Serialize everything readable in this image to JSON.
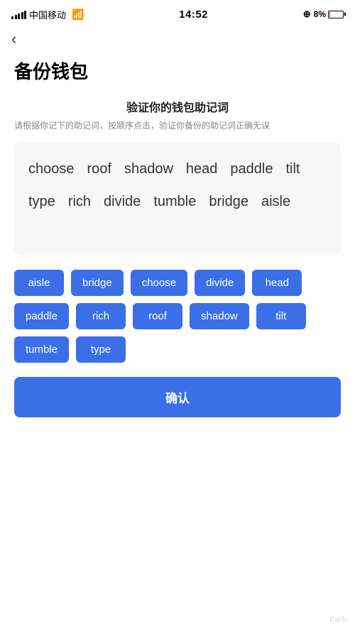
{
  "statusBar": {
    "carrier": "中国移动",
    "time": "14:52",
    "batteryPercent": "8%"
  },
  "nav": {
    "backLabel": "‹"
  },
  "page": {
    "title": "备份钱包",
    "sectionTitle": "验证你的钱包助记词",
    "sectionDesc": "请根据你记下的助记词，按顺序点击，验证你备份的助记词正确无误"
  },
  "displayWords": [
    "choose",
    "roof",
    "shadow",
    "head",
    "paddle",
    "tilt",
    "type",
    "rich",
    "divide",
    "tumble",
    "bridge",
    "aisle"
  ],
  "wordButtons": [
    "aisle",
    "bridge",
    "choose",
    "divide",
    "head",
    "paddle",
    "rich",
    "roof",
    "shadow",
    "tilt",
    "tumble",
    "type"
  ],
  "confirmButton": {
    "label": "确认"
  }
}
